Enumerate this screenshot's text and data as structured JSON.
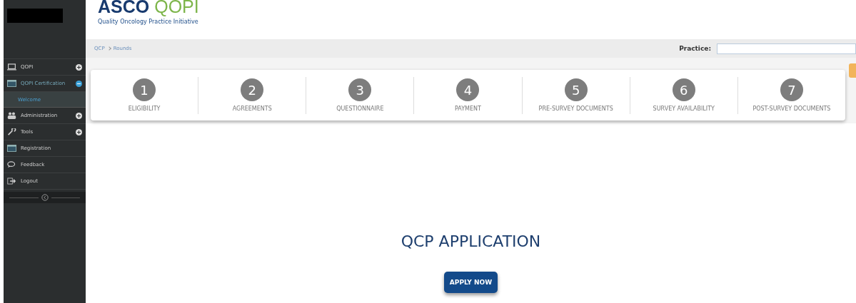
{
  "header": {
    "brand": "ASCO",
    "product": "QOPI",
    "tagline": "Quality Oncology Practice Initiative"
  },
  "breadcrumb": [
    "QCP",
    "Rounds"
  ],
  "practice": {
    "label": "Practice:"
  },
  "sidebar": {
    "items": [
      {
        "label": "QOPI",
        "expanded": false
      },
      {
        "label": "QOPI Certification",
        "expanded": true,
        "children": [
          {
            "label": "Welcome",
            "selected": true
          }
        ]
      },
      {
        "label": "Administration",
        "expanded": false
      },
      {
        "label": "Tools",
        "expanded": false
      },
      {
        "label": "Registration"
      },
      {
        "label": "Feedback"
      },
      {
        "label": "Logout"
      }
    ]
  },
  "steps": [
    {
      "number": "1",
      "label": "ELIGIBILITY"
    },
    {
      "number": "2",
      "label": "AGREEMENTS"
    },
    {
      "number": "3",
      "label": "QUESTIONNAIRE"
    },
    {
      "number": "4",
      "label": "PAYMENT"
    },
    {
      "number": "5",
      "label": "PRE-SURVEY DOCUMENTS"
    },
    {
      "number": "6",
      "label": "SURVEY AVAILABILITY"
    },
    {
      "number": "7",
      "label": "POST-SURVEY DOCUMENTS"
    }
  ],
  "main": {
    "title": "QCP APPLICATION",
    "button": "APPLY NOW"
  }
}
